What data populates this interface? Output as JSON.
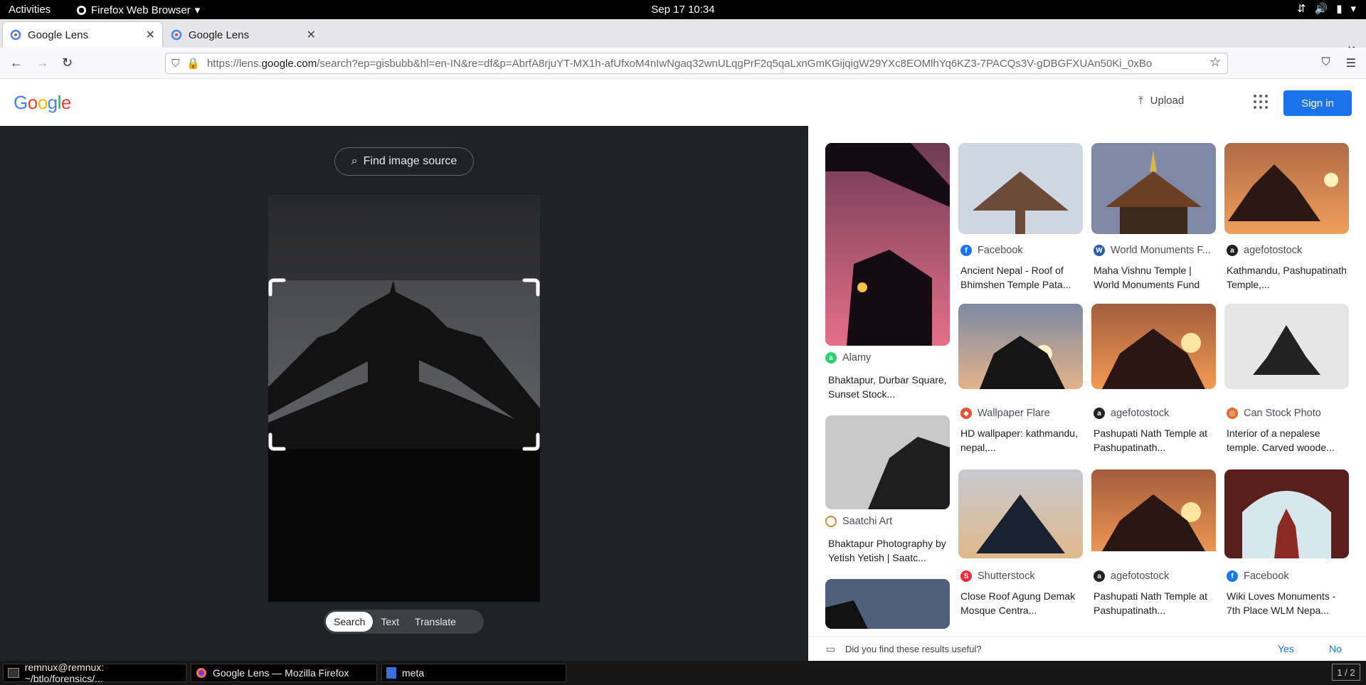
{
  "system": {
    "activities": "Activities",
    "app_name": "Firefox Web Browser",
    "clock": "Sep 17  10:34"
  },
  "browser": {
    "tabs": [
      {
        "label": "Google Lens"
      },
      {
        "label": "Google Lens"
      }
    ],
    "url_prefix": "https://lens.",
    "url_domain": "google.com",
    "url_rest": "/search?ep=gisbubb&hl=en-IN&re=df&p=AbrfA8rjuYT-MX1h-afUfxoM4nIwNgaq32wnULqgPrF2q5qaLxnGmKGijqigW29YXc8EOMlhYq6KZ3-7PACQs3V-gDBGFXUAn50Ki_0xBo"
  },
  "header": {
    "logo": "Google",
    "upload": "Upload",
    "signin": "Sign in"
  },
  "lens": {
    "find_source": "Find image source",
    "modes": [
      "Search",
      "Text",
      "Translate"
    ]
  },
  "results": [
    {
      "source": "Alamy",
      "title": "Bhaktapur, Durbar Square, Sunset Stock...",
      "icon_color": "#2bd46b"
    },
    {
      "source": "Saatchi Art",
      "title": "Bhaktapur Photography by Yetish Yetish | Saatc...",
      "icon_color": "#d98a2a"
    },
    {
      "source": "Facebook",
      "title": "Ancient Nepal - Roof of Bhimshen Temple Pata...",
      "icon_color": "#1877f2"
    },
    {
      "source": "Wallpaper Flare",
      "title": "HD wallpaper: kathmandu, nepal,...",
      "icon_color": "#e3543a"
    },
    {
      "source": "Shutterstock",
      "title": "Close Roof Agung Demak Mosque Centra...",
      "icon_color": "#ee2d3e"
    },
    {
      "source": "World Monuments F...",
      "title": "Maha Vishnu Temple | World Monuments Fund",
      "icon_color": "#2a5db0"
    },
    {
      "source": "agefotostock",
      "title": "Pashupati Nath Temple at Pashupatinath...",
      "icon_color": "#222222"
    },
    {
      "source": "agefotostock",
      "title": "Pashupati Nath Temple at Pashupatinath...",
      "icon_color": "#222222"
    },
    {
      "source": "agefotostock",
      "title": "Kathmandu, Pashupatinath Temple,...",
      "icon_color": "#222222"
    },
    {
      "source": "Can Stock Photo",
      "title": "Interior of a nepalese temple. Carved woode...",
      "icon_color": "#e86b2c"
    },
    {
      "source": "Facebook",
      "title": "Wiki Loves Monuments - 7th Place WLM Nepa...",
      "icon_color": "#1877f2"
    }
  ],
  "feedback": {
    "question": "Did you find these results useful?",
    "yes": "Yes",
    "no": "No"
  },
  "taskbar": [
    {
      "label": "remnux@remnux: ~/btlo/forensics/..."
    },
    {
      "label": "Google Lens — Mozilla Firefox"
    },
    {
      "label": "meta"
    }
  ],
  "workspace": "1 / 2"
}
